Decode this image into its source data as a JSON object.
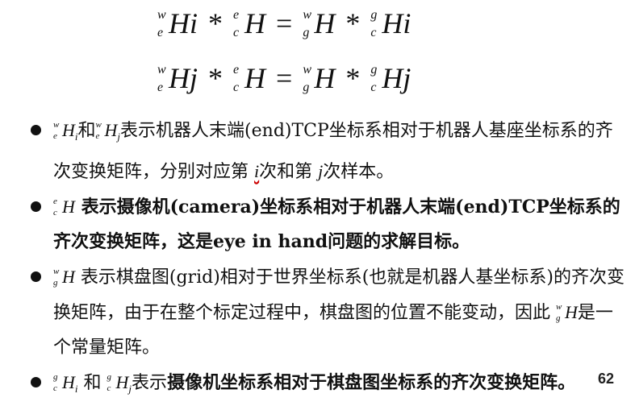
{
  "equations": {
    "eq1": {
      "t1_sup": "w",
      "t1_sub": "e",
      "t1_base": "H",
      "t1_idx": "i",
      "op1": "*",
      "t2_sup": "e",
      "t2_sub": "c",
      "t2_base": "H",
      "op2": "=",
      "t3_sup": "w",
      "t3_sub": "g",
      "t3_base": "H",
      "op3": "*",
      "t4_sup": "g",
      "t4_sub": "c",
      "t4_base": "H",
      "t4_idx": "i"
    },
    "eq2": {
      "t1_sup": "w",
      "t1_sub": "e",
      "t1_base": "H",
      "t1_idx": "j",
      "op1": "*",
      "t2_sup": "e",
      "t2_sub": "c",
      "t2_base": "H",
      "op2": "=",
      "t3_sup": "w",
      "t3_sub": "g",
      "t3_base": "H",
      "op3": "*",
      "t4_sup": "g",
      "t4_sub": "c",
      "t4_base": "H",
      "t4_idx": "j"
    }
  },
  "bullets": [
    {
      "text_a": "和",
      "text_b": "表示机器人末端(end)TCP坐标系相对于机器人基座坐标系的齐次变换矩阵，分别对应第",
      "var1": "i",
      "text_c": "次和第",
      "var2": "j",
      "text_d": "次样本。"
    },
    {
      "text": "表示摄像机(camera)坐标系相对于机器人末端(end)TCP坐标系的齐次变换矩阵，这是eye in hand问题的求解目标。"
    },
    {
      "text": "表示棋盘图(grid)相对于世界坐标系(也就是机器人基坐标系)的齐次变换矩阵，由于在整个标定过程中，棋盘图的位置不能变动，因此",
      "text_end": "是一个常量矩阵。"
    },
    {
      "text_a": "和",
      "text_b": "表示",
      "text_c": "摄像机坐标系相对于棋盘图坐标系的齐次变换矩阵。"
    }
  ],
  "page_number": "62"
}
